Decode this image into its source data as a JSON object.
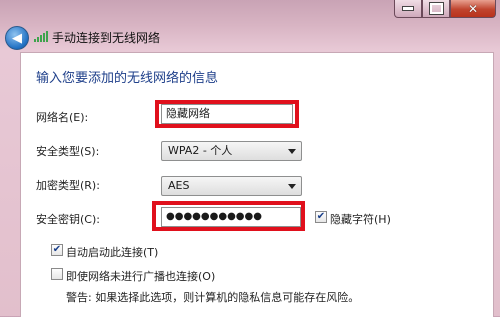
{
  "window": {
    "title": "手动连接到无线网络",
    "back_glyph": "◀",
    "close_glyph": "✕"
  },
  "form": {
    "heading": "输入您要添加的无线网络的信息",
    "network_name": {
      "label": "网络名(E):",
      "value": "隐藏网络"
    },
    "security_type": {
      "label": "安全类型(S):",
      "value": "WPA2 - 个人"
    },
    "encryption_type": {
      "label": "加密类型(R):",
      "value": "AES"
    },
    "security_key": {
      "label": "安全密钥(C):",
      "value": "●●●●●●●●●●●"
    },
    "hide_chars": {
      "label": "隐藏字符(H)",
      "checked": true,
      "check_glyph": "✔"
    },
    "auto_start": {
      "label": "自动启动此连接(T)",
      "checked": true,
      "check_glyph": "✔"
    },
    "connect_no_broadcast": {
      "label": "即使网络未进行广播也连接(O)",
      "checked": false
    },
    "warning": "警告: 如果选择此选项，则计算机的隐私信息可能存在风险。"
  },
  "colors": {
    "highlight": "#e0101c",
    "heading": "#1e3f8a",
    "window_frame": "#e2bfcc"
  }
}
